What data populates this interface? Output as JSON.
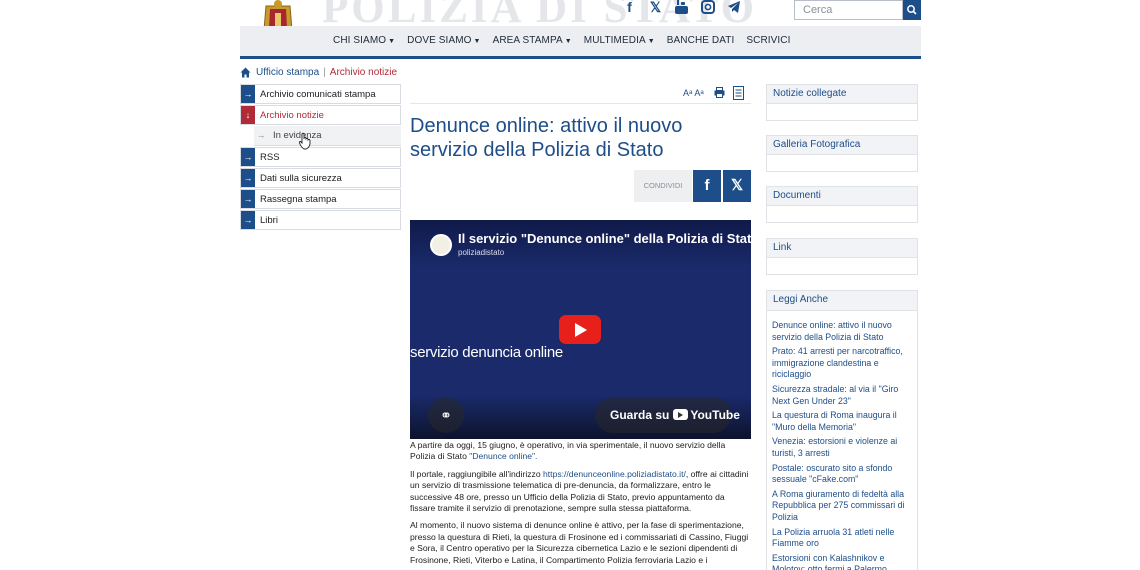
{
  "header": {
    "site_title": "POLIZIA DI STATO",
    "search_placeholder": "Cerca",
    "social_icons": [
      "facebook-icon",
      "x-icon",
      "youtube-icon",
      "instagram-icon",
      "telegram-icon"
    ],
    "nav": [
      {
        "label": "CHI SIAMO",
        "dropdown": true
      },
      {
        "label": "DOVE SIAMO",
        "dropdown": true
      },
      {
        "label": "AREA STAMPA",
        "dropdown": true
      },
      {
        "label": "MULTIMEDIA",
        "dropdown": true
      },
      {
        "label": "BANCHE DATI",
        "dropdown": false
      },
      {
        "label": "SCRIVICI",
        "dropdown": false
      }
    ]
  },
  "breadcrumb": {
    "items": [
      "Ufficio stampa",
      "Archivio notizie"
    ]
  },
  "sidebar": {
    "items": [
      {
        "label": "Archivio comunicati stampa"
      },
      {
        "label": "Archivio notizie"
      },
      {
        "label": "In evidenza"
      },
      {
        "label": "RSS"
      },
      {
        "label": "Dati sulla sicurezza"
      },
      {
        "label": "Rassegna stampa"
      },
      {
        "label": "Libri"
      }
    ]
  },
  "article": {
    "tools": {
      "font_size": "Aᵃ Aᵃ"
    },
    "title": "Denunce online: attivo il nuovo servizio della Polizia di Stato",
    "share_label": "CONDIVIDI",
    "video": {
      "title": "Il servizio \"Denunce online\" della Polizia di Stato",
      "channel": "poliziadistato",
      "overlay_text": "servizio denuncia online",
      "watch_label": "Guarda su",
      "watch_brand": "YouTube"
    },
    "paragraphs": {
      "p1": "A partire da oggi, 15 giugno, è operativo, in via sperimentale, il nuovo servizio della Polizia di Stato ",
      "p1_link": "\"Denunce online\".",
      "p2_a": "Il portale, raggiungibile all'indirizzo ",
      "p2_link": "https://denunceonline.poliziadistato.it/",
      "p2_b": ", offre ai cittadini un servizio di trasmissione telematica di pre-denuncia, da formalizzare, entro le successive 48 ore, presso un Ufficio della Polizia di Stato, previo appuntamento da fissare tramite il servizio di prenotazione, sempre sulla stessa piattaforma.",
      "p3": "Al momento, il nuovo sistema di denunce online è attivo, per la fase di sperimentazione, presso la questura di Rieti, la questura di Frosinone ed i commissariati di Cassino, Fiuggi e Sora, il Centro operativo per la Sicurezza cibernetica Lazio e le sezioni dipendenti di Frosinone, Rieti, Viterbo e Latina, il Compartimento Polizia ferroviaria Lazio e i"
    }
  },
  "right": {
    "boxes": [
      {
        "title": "Notizie collegate"
      },
      {
        "title": "Galleria Fotografica"
      },
      {
        "title": "Documenti"
      },
      {
        "title": "Link"
      }
    ],
    "read_also_title": "Leggi Anche",
    "read_also": [
      "Denunce online: attivo il nuovo servizio della Polizia di Stato",
      "Prato: 41 arresti per narcotraffico, immigrazione clandestina e riciclaggio",
      "Sicurezza stradale: al via il \"Giro Next Gen Under 23\"",
      "La questura di Roma inaugura il \"Muro della Memoria\"",
      "Venezia: estorsioni e violenze ai turisti, 3 arresti",
      "Postale: oscurato sito a sfondo sessuale \"cFake.com\"",
      "A Roma giuramento di fedeltà alla Repubblica per 275 commissari di Polizia",
      "La Polizia arruola 31 atleti nelle Fiamme oro",
      "Estorsioni con Kalashnikov e Molotov: otto fermi a Palermo"
    ]
  },
  "colors": {
    "brand_blue": "#1d4e89",
    "active_red": "#b02b37",
    "youtube_red": "#e8201c"
  }
}
